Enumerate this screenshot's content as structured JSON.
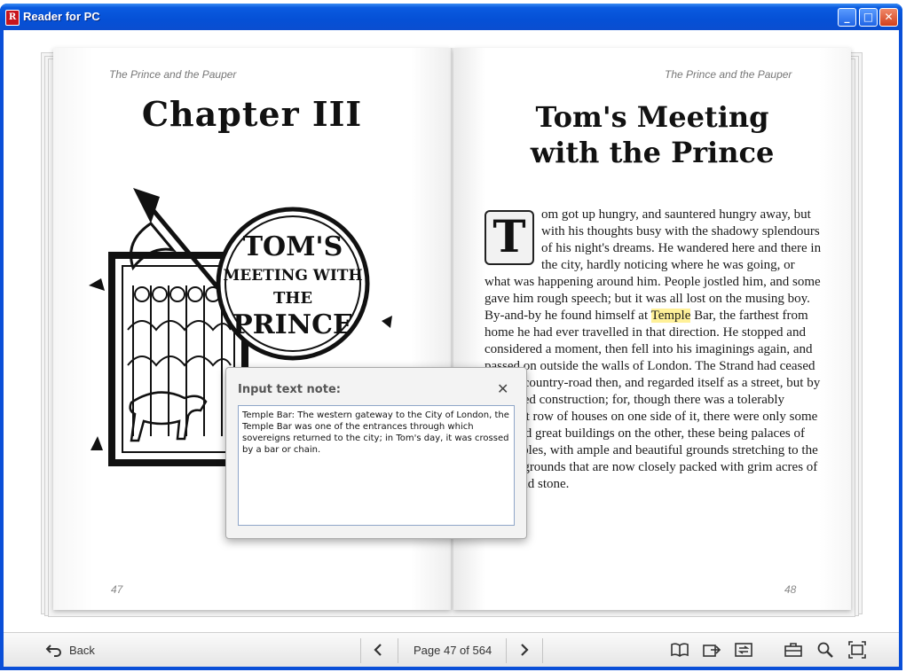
{
  "window": {
    "title": "Reader for PC",
    "app_icon_glyph": "R"
  },
  "window_controls": {
    "minimize": "_",
    "maximize": "□",
    "close": "✕"
  },
  "book": {
    "left_page": {
      "running_head": "The Prince and the Pauper",
      "chapter_title": "Chapter III",
      "illustration_text": [
        "TOM'S",
        "MEETING WITH",
        "THE",
        "PRINCE"
      ],
      "page_number": "47"
    },
    "right_page": {
      "running_head": "The Prince and the Pauper",
      "title_line1": "Tom's Meeting",
      "title_line2": "with the Prince",
      "dropcap": "T",
      "para_before": "om got up hungry, and sauntered hungry away, but with his thoughts busy with the shadowy splendours of his night's dreams. He wandered here and there in the city, hardly noticing where he was going, or what was happening around him. People jostled him, and some gave him rough speech; but it was all lost on the musing boy. By-and-by he found himself at",
      "highlight": "Temple",
      "para_after": " Bar, the farthest from home he had ever travelled in that direction. He stopped and considered a moment, then fell into his imaginings again, and passed on outside the walls of London. The Strand had ceased to be a country-road then, and regarded itself as a street, but by a strained construction; for, though there was a tolerably compact row of houses on one side of it, there were only some scattered great buildings on the other, these being palaces of rich nobles, with ample and beautiful grounds stretching to the river – grounds that are now closely packed with grim acres of brick and stone.",
      "page_number": "48"
    }
  },
  "note_popup": {
    "title": "Input text note:",
    "close_label": "✕",
    "text": "Temple Bar: The western gateway to the City of London, the Temple Bar was one of the entrances through which sovereigns returned to the city; in Tom's day, it was crossed by a bar or chain."
  },
  "toolbar": {
    "back_label": "Back",
    "page_indicator": "Page 47 of 564",
    "icons": [
      "back-arrow-icon",
      "prev-page-icon",
      "next-page-icon",
      "book-icon",
      "export-icon",
      "sync-icon",
      "briefcase-icon",
      "search-icon",
      "fit-screen-icon"
    ]
  }
}
